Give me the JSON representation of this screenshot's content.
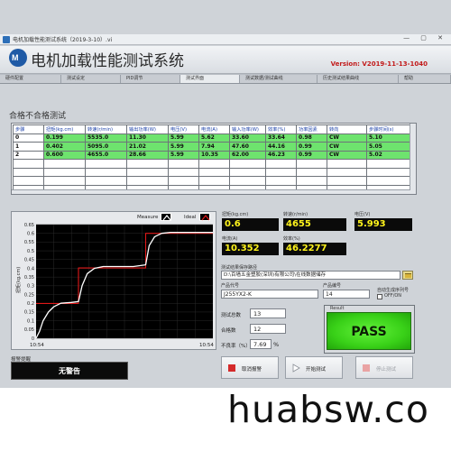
{
  "window": {
    "title": "电机加载性能测试系统（2019-3-10）.vi",
    "controls": "— ▢ ✕"
  },
  "header": {
    "logo_text": "M",
    "app_title": "电机加载性能测试系统",
    "version": "Version: V2019-11-13-1040"
  },
  "tabs": [
    "硬件配置",
    "测试设定",
    "PID调节",
    "测试界面",
    "测试数据/测试曲线",
    "历史测试结果曲线",
    "帮助"
  ],
  "active_tab": 3,
  "table": {
    "title": "合格不合格测试",
    "headers": [
      "步骤",
      "扭矩(kg.cm)",
      "转速(r/min)",
      "输出功率(W)",
      "电压(V)",
      "电流(A)",
      "输入功率(W)",
      "效率(%)",
      "功率因素",
      "转向",
      "步骤时间(s)"
    ],
    "rows": [
      [
        "0",
        "0.199",
        "5535.0",
        "11.30",
        "5.99",
        "5.62",
        "33.60",
        "33.64",
        "0.98",
        "CW",
        "5.10"
      ],
      [
        "1",
        "0.402",
        "5095.0",
        "21.02",
        "5.99",
        "7.94",
        "47.60",
        "44.16",
        "0.99",
        "CW",
        "5.05"
      ],
      [
        "2",
        "0.600",
        "4655.0",
        "28.66",
        "5.99",
        "10.35",
        "62.00",
        "46.23",
        "0.99",
        "CW",
        "5.02"
      ]
    ],
    "highlight_color": "#6ee36e"
  },
  "chart_data": {
    "type": "line",
    "legend": [
      "Measure",
      "Ideal"
    ],
    "y_axis_label": "扭矩(kg.cm)",
    "ylim": [
      0,
      0.65
    ],
    "y_ticks": [
      "0.65",
      "0.6",
      "0.55",
      "0.5",
      "0.45",
      "0.4",
      "0.35",
      "0.3",
      "0.25",
      "0.2",
      "0.15",
      "0.1",
      "0.05",
      "0"
    ],
    "x_ticks": [
      "10:54",
      "10:54"
    ],
    "xlim": [
      0,
      100
    ],
    "series": [
      {
        "name": "Ideal",
        "color": "#e01818",
        "x": [
          0,
          24,
          24,
          62,
          62,
          100
        ],
        "y": [
          0.199,
          0.199,
          0.402,
          0.402,
          0.6,
          0.6
        ]
      },
      {
        "name": "Measure",
        "color": "#ffffff",
        "x": [
          0,
          2,
          4,
          7,
          10,
          14,
          20,
          24,
          26,
          29,
          33,
          38,
          45,
          55,
          62,
          64,
          67,
          71,
          76,
          85,
          100
        ],
        "y": [
          0,
          0.04,
          0.1,
          0.15,
          0.18,
          0.2,
          0.205,
          0.21,
          0.3,
          0.37,
          0.4,
          0.41,
          0.41,
          0.41,
          0.42,
          0.53,
          0.58,
          0.6,
          0.605,
          0.605,
          0.605
        ]
      }
    ],
    "grid": true
  },
  "alarm": {
    "label": "报警提醒",
    "value": "无警告"
  },
  "readouts": {
    "torque_label": "扭矩(kg.cm)",
    "torque": "0.6",
    "speed_label": "转速(r/min)",
    "speed": "4655",
    "voltage_label": "电压(V)",
    "voltage": "5.993",
    "current_label": "电流(A)",
    "current": "10.352",
    "efficiency_label": "效率(%)",
    "efficiency": "46.2277"
  },
  "save_path": {
    "label": "测试结果保存路径",
    "value": "D:\\百墙五金塑胶(深圳)有限公司\\在线数据储存"
  },
  "product": {
    "code_label": "产品代号",
    "code": "J255YX2-K",
    "number_label": "产品编号",
    "number": "14",
    "auto_label": "自动生成序列号",
    "onoff": "OFF/ON"
  },
  "stats": {
    "total_label": "测试总数",
    "total": "13",
    "pass_label": "合格数",
    "pass": "12",
    "fail_rate_label": "不良率（%）",
    "fail_rate": "7.69",
    "fail_rate_unit": "%"
  },
  "result": {
    "label": "Result",
    "value": "PASS"
  },
  "buttons": {
    "cancel_alarm": "取消报警",
    "start_test": "开始测试",
    "stop_test": "停止测试"
  },
  "watermark": "huabsw.co"
}
